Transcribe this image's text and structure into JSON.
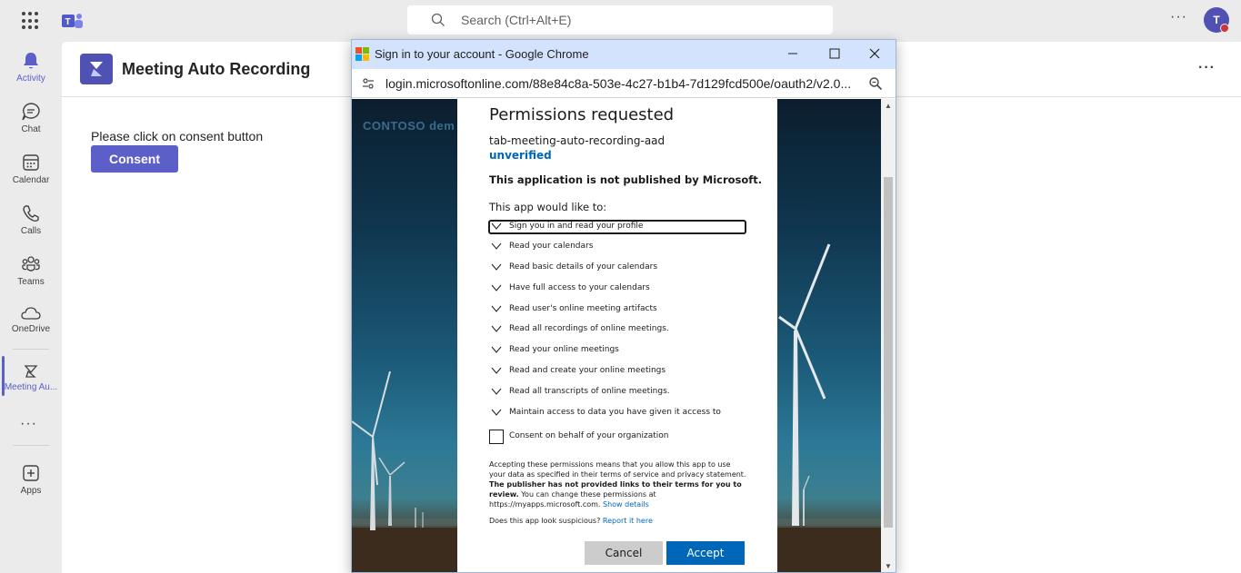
{
  "topbar": {
    "search_placeholder": "Search (Ctrl+Alt+E)",
    "more_label": "···",
    "avatar_initial": "T"
  },
  "rail": {
    "items": [
      {
        "label": "Activity",
        "icon": "bell-icon"
      },
      {
        "label": "Chat",
        "icon": "chat-icon"
      },
      {
        "label": "Calendar",
        "icon": "calendar-icon"
      },
      {
        "label": "Calls",
        "icon": "phone-icon"
      },
      {
        "label": "Teams",
        "icon": "teams-icon"
      },
      {
        "label": "OneDrive",
        "icon": "cloud-icon"
      },
      {
        "label": "Meeting Au...",
        "icon": "meeting-app-icon"
      },
      {
        "label": "Apps",
        "icon": "add-icon"
      }
    ],
    "more_label": "···"
  },
  "app": {
    "title": "Meeting Auto Recording",
    "more_label": "···",
    "consent_prompt": "Please click on consent button",
    "consent_button": "Consent"
  },
  "popup": {
    "window_title": "Sign in to your account - Google Chrome",
    "url": "login.microsoftonline.com/88e84c8a-503e-4c27-b1b4-7d129fcd500e/oauth2/v2.0...",
    "background_brand": "CONTOSO dem",
    "dialog": {
      "title": "Permissions requested",
      "app_name": "tab-meeting-auto-recording-aad",
      "unverified": "unverified",
      "not_published": "This application is not published by Microsoft.",
      "would_like": "This app would like to:",
      "permissions": [
        "Sign you in and read your profile",
        "Read your calendars",
        "Read basic details of your calendars",
        "Have full access to your calendars",
        "Read user's online meeting artifacts",
        "Read all recordings of online meetings.",
        "Read your online meetings",
        "Read and create your online meetings",
        "Read all transcripts of online meetings.",
        "Maintain access to data you have given it access to"
      ],
      "consent_org": "Consent on behalf of your organization",
      "legal_1": "Accepting these permissions means that you allow this app to use your data as specified in their terms of service and privacy statement.",
      "legal_bold": "The publisher has not provided links to their terms for you to review.",
      "legal_2": "You can change these permissions at https://myapps.microsoft.com.",
      "show_details": "Show details",
      "suspicious": "Does this app look suspicious?",
      "report": "Report it here",
      "cancel": "Cancel",
      "accept": "Accept"
    }
  },
  "colors": {
    "teams_accent": "#5b5fc7",
    "ms_blue": "#0067b8",
    "chrome_titlebar": "#d3e3fd"
  }
}
